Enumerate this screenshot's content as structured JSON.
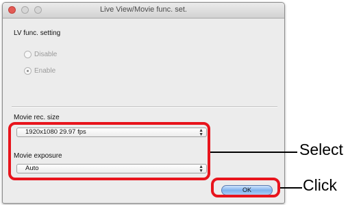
{
  "window": {
    "title": "Live View/Movie func. set."
  },
  "lv_func": {
    "heading": "LV func. setting",
    "options": [
      {
        "label": "Disable",
        "selected": false
      },
      {
        "label": "Enable",
        "selected": true
      }
    ]
  },
  "movie_rec_size": {
    "label": "Movie rec. size",
    "value": "1920x1080 29.97 fps"
  },
  "movie_exposure": {
    "label": "Movie exposure",
    "value": "Auto"
  },
  "ok_button": {
    "label": "OK"
  },
  "annotations": {
    "select_label": "Select",
    "click_label": "Click",
    "highlight_color": "#e8141c"
  },
  "icons": {
    "select_arrows": "updown-chevron-icon"
  }
}
